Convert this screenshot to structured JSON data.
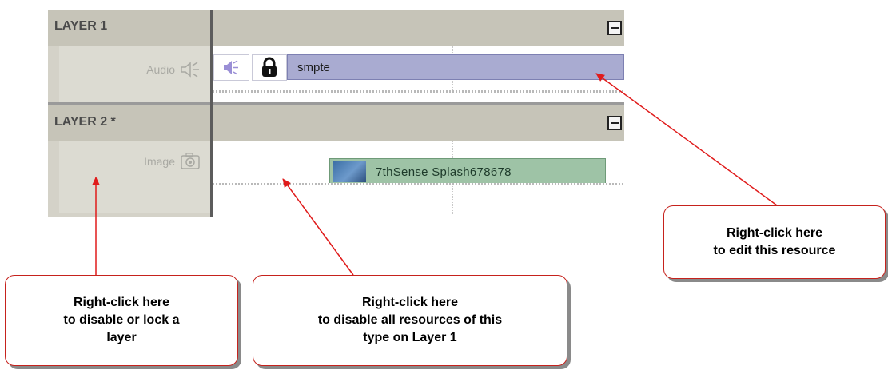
{
  "layers": [
    {
      "name": "LAYER 1",
      "type_label": "Audio",
      "type_icon": "speaker-icon",
      "clip": {
        "label": "smpte",
        "color": "#a9abd1",
        "icons": [
          "speaker-icon",
          "lock-icon"
        ]
      }
    },
    {
      "name": "LAYER 2 *",
      "type_label": "Image",
      "type_icon": "camera-icon",
      "clip": {
        "label": "7thSense Splash678678",
        "color": "#9ec3a6",
        "icons": [
          "thumbnail-image"
        ]
      }
    }
  ],
  "callouts": {
    "resource": "Right-click here\nto edit this resource",
    "layer": "Right-click here\nto disable or lock a\nlayer",
    "type": "Right-click here\nto disable all resources of this\ntype on Layer 1"
  },
  "colors": {
    "arrow": "#e01b1b",
    "callout_border": "#c6221d"
  }
}
